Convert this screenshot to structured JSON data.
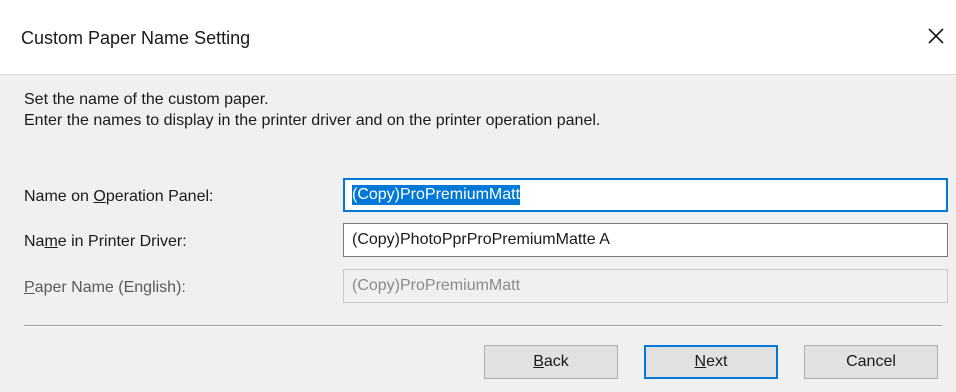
{
  "window": {
    "title": "Custom Paper Name Setting",
    "close_icon": "close-icon"
  },
  "description": {
    "line1": "Set the name of the custom paper.",
    "line2": "Enter the names to display in the printer driver and on the printer operation panel."
  },
  "fields": {
    "operation_panel": {
      "label_pre": "Name on ",
      "label_mnemonic": "O",
      "label_post": "peration Panel:",
      "value": "(Copy)ProPremiumMatt"
    },
    "printer_driver": {
      "label_pre": "Na",
      "label_mnemonic": "m",
      "label_post": "e in Printer Driver:",
      "value": "(Copy)PhotoPprProPremiumMatte A"
    },
    "paper_name_english": {
      "label_pre": "",
      "label_mnemonic": "P",
      "label_post": "aper Name (English):",
      "value": "(Copy)ProPremiumMatt"
    }
  },
  "buttons": {
    "back": {
      "mnemonic": "B",
      "rest": "ack"
    },
    "next": {
      "mnemonic": "N",
      "rest": "ext"
    },
    "cancel": {
      "label": "Cancel"
    }
  },
  "colors": {
    "accent": "#0078d7",
    "dialog_bg": "#f0f0f0"
  }
}
